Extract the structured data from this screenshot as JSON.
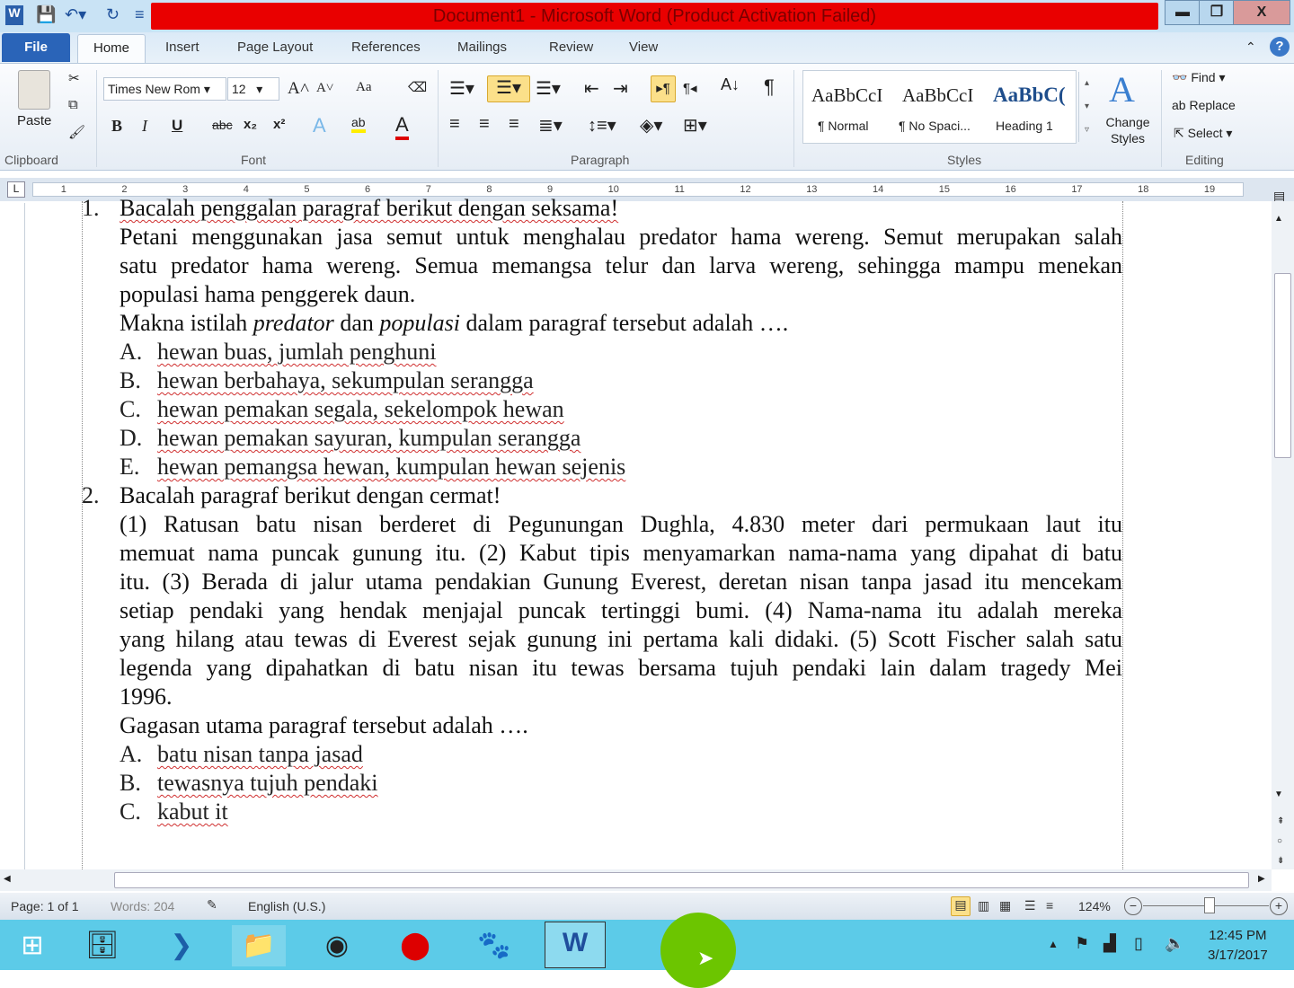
{
  "window": {
    "title": "Document1  -  Microsoft Word (Product Activation Failed)",
    "min": "▬",
    "restore": "❐",
    "close": "X"
  },
  "tabs": [
    "File",
    "Home",
    "Insert",
    "Page Layout",
    "References",
    "Mailings",
    "Review",
    "View"
  ],
  "ribbon": {
    "paste": "Paste",
    "clipboard": "Clipboard",
    "font_name": "Times New Rom",
    "font_size": "12",
    "font": "Font",
    "paragraph": "Paragraph",
    "styles": [
      {
        "preview": "AaBbCcI",
        "name": "¶ Normal"
      },
      {
        "preview": "AaBbCcI",
        "name": "¶ No Spaci..."
      },
      {
        "preview": "AaBbC(",
        "name": "Heading 1"
      }
    ],
    "styles_group": "Styles",
    "change_styles": "Change Styles",
    "find": "Find",
    "replace": "Replace",
    "select": "Select",
    "editing": "Editing",
    "bold": "B",
    "italic": "I",
    "underline": "U",
    "strike": "abc",
    "sub": "x₂",
    "sup": "x²",
    "case": "Aa",
    "grow": "A˄",
    "shrink": "A˅"
  },
  "ruler": [
    "1",
    "2",
    "3",
    "4",
    "5",
    "6",
    "7",
    "8",
    "9",
    "10",
    "11",
    "12",
    "13",
    "14",
    "15",
    "16",
    "17",
    "18",
    "19"
  ],
  "document": {
    "q1_num": "1.",
    "q1_title": "Bacalah penggalan paragraf berikut dengan seksama!",
    "q1_lines": [
      "Petani menggunakan jasa semut untuk menghalau predator hama wereng. Semut merupakan salah",
      "satu predator hama wereng. Semua memangsa telur dan larva wereng, sehingga mampu menekan",
      "populasi hama penggerek daun."
    ],
    "q1_question": {
      "a": "Makna istilah ",
      "b": "predator",
      "c": " dan ",
      "d": "populasi",
      "e": " dalam paragraf tersebut adalah …."
    },
    "q1_options": [
      {
        "l": "A.",
        "t": "hewan buas, jumlah penghuni"
      },
      {
        "l": "B.",
        "t": "hewan berbahaya, sekumpulan serangga"
      },
      {
        "l": "C.",
        "t": "hewan pemakan segala, sekelompok hewan"
      },
      {
        "l": "D.",
        "t": "hewan pemakan sayuran, kumpulan serangga"
      },
      {
        "l": "E.",
        "t": "hewan pemangsa hewan, kumpulan hewan sejenis"
      }
    ],
    "q2_num": "2.",
    "q2_title": "Bacalah paragraf berikut dengan cermat!",
    "q2_lines": [
      "(1) Ratusan batu nisan berderet di Pegunungan Dughla, 4.830 meter dari permukaan laut itu",
      "memuat nama puncak gunung itu. (2) Kabut tipis menyamarkan nama-nama yang dipahat di batu",
      "itu. (3) Berada di jalur utama pendakian Gunung Everest, deretan nisan tanpa jasad itu mencekam",
      "setiap pendaki yang hendak menjajal puncak tertinggi bumi. (4) Nama-nama itu adalah mereka",
      "yang hilang atau tewas di Everest sejak gunung ini pertama kali didaki. (5) Scott Fischer salah satu",
      "legenda yang dipahatkan di batu nisan itu tewas bersama tujuh pendaki lain dalam tragedy Mei",
      "1996."
    ],
    "q2_question": "Gagasan utama paragraf tersebut adalah ….",
    "q2_options": [
      {
        "l": "A.",
        "t": "batu nisan tanpa jasad"
      },
      {
        "l": "B.",
        "t": "tewasnya tujuh pendaki"
      },
      {
        "l": "C.",
        "t": "kabut it"
      }
    ]
  },
  "status": {
    "page": "Page: 1 of 1",
    "words": "Words: 204",
    "language": "English (U.S.)",
    "zoom": "124%"
  },
  "taskbar": {
    "time": "12:45 PM",
    "date": "3/17/2017"
  },
  "colors": {
    "title_bar": "#e90000",
    "taskbar": "#5ccbe8",
    "file_tab": "#2a64b8"
  }
}
